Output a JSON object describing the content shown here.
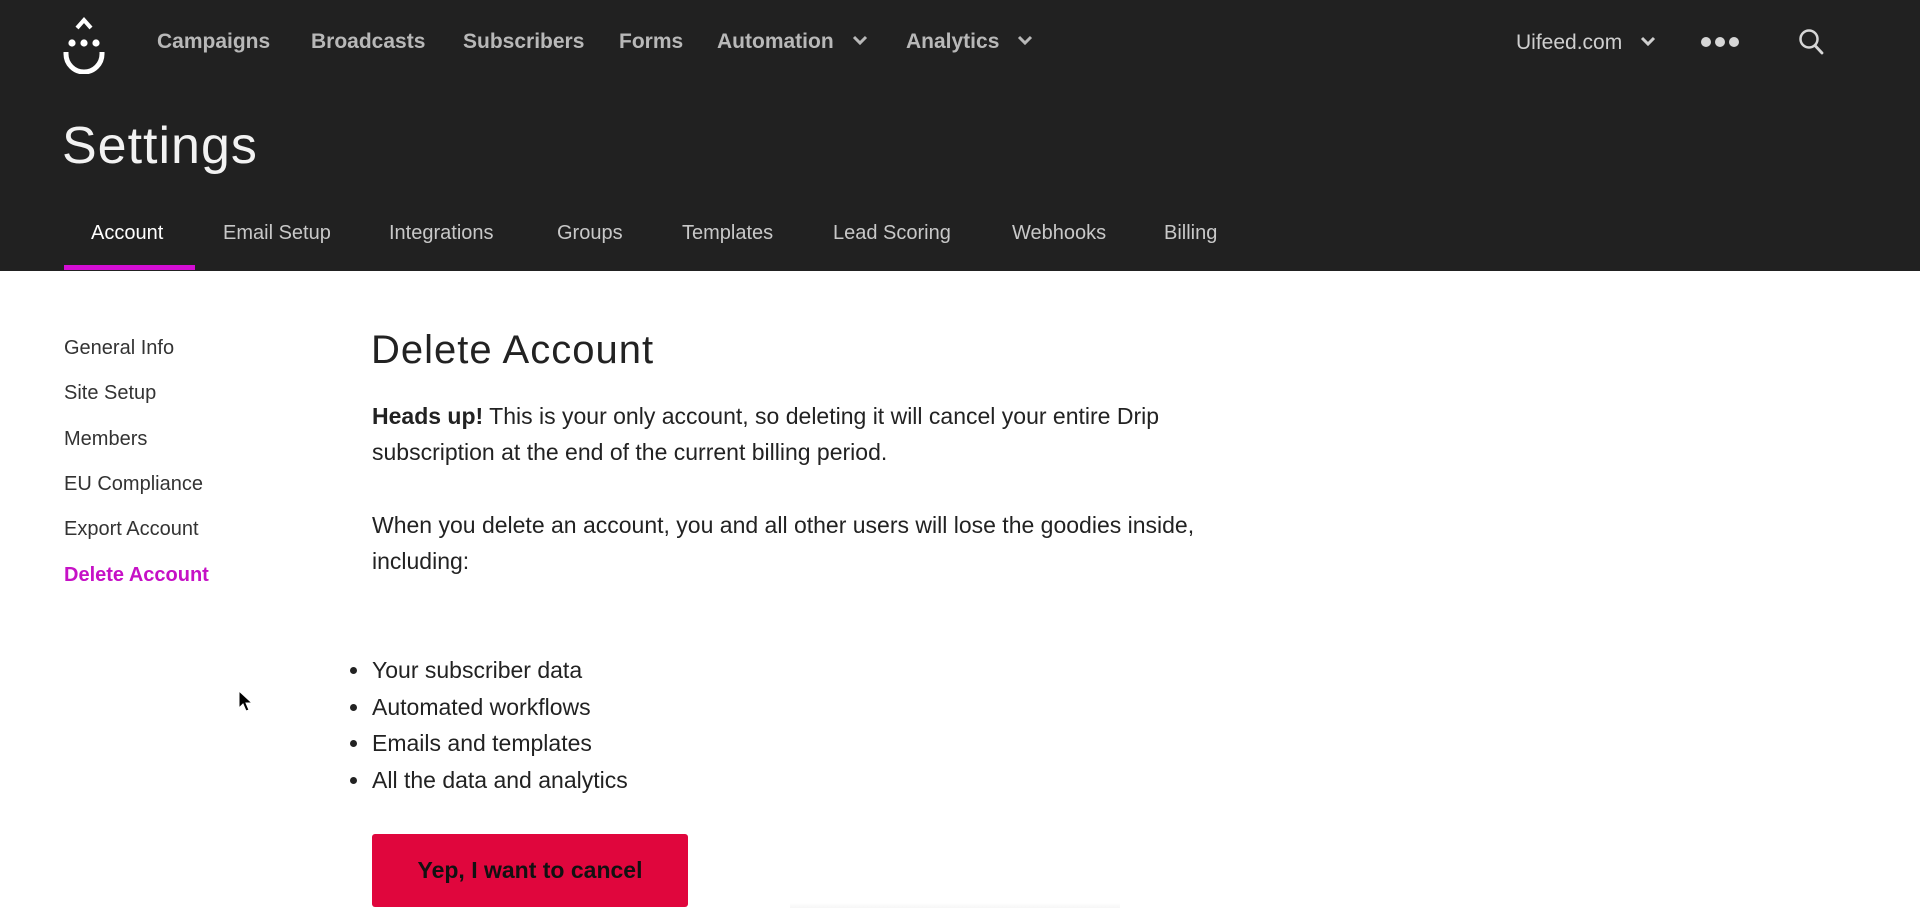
{
  "topnav": {
    "logo_icon": "drip-logo-icon",
    "items": [
      {
        "label": "Campaigns",
        "has_dropdown": false
      },
      {
        "label": "Broadcasts",
        "has_dropdown": false
      },
      {
        "label": "Subscribers",
        "has_dropdown": false
      },
      {
        "label": "Forms",
        "has_dropdown": false
      },
      {
        "label": "Automation",
        "has_dropdown": true
      },
      {
        "label": "Analytics",
        "has_dropdown": true
      }
    ],
    "account_label": "Uifeed.com",
    "more_icon": "more-dots-icon",
    "search_icon": "search-icon"
  },
  "page": {
    "title": "Settings"
  },
  "tabs": [
    {
      "label": "Account",
      "active": true
    },
    {
      "label": "Email Setup",
      "active": false
    },
    {
      "label": "Integrations",
      "active": false
    },
    {
      "label": "Groups",
      "active": false
    },
    {
      "label": "Templates",
      "active": false
    },
    {
      "label": "Lead Scoring",
      "active": false
    },
    {
      "label": "Webhooks",
      "active": false
    },
    {
      "label": "Billing",
      "active": false
    }
  ],
  "sidebar": {
    "items": [
      {
        "label": "General Info",
        "active": false
      },
      {
        "label": "Site Setup",
        "active": false
      },
      {
        "label": "Members",
        "active": false
      },
      {
        "label": "EU Compliance",
        "active": false
      },
      {
        "label": "Export Account",
        "active": false
      },
      {
        "label": "Delete Account",
        "active": true
      }
    ]
  },
  "content": {
    "title": "Delete Account",
    "warning_bold": "Heads up!",
    "warning_text": " This is your only account, so deleting it will cancel your entire Drip subscription at the end of the current billing period.",
    "intro": "When you delete an account, you and all other users will lose the goodies inside, including:",
    "loss_items": [
      "Your subscriber data",
      "Automated workflows",
      "Emails and templates",
      "All the data and analytics"
    ],
    "confirm_button": "Yep, I want to cancel"
  },
  "colors": {
    "header_bg": "#212121",
    "accent": "#d40dd4",
    "active_sidebar": "#c611c6",
    "danger": "#e0063d"
  }
}
